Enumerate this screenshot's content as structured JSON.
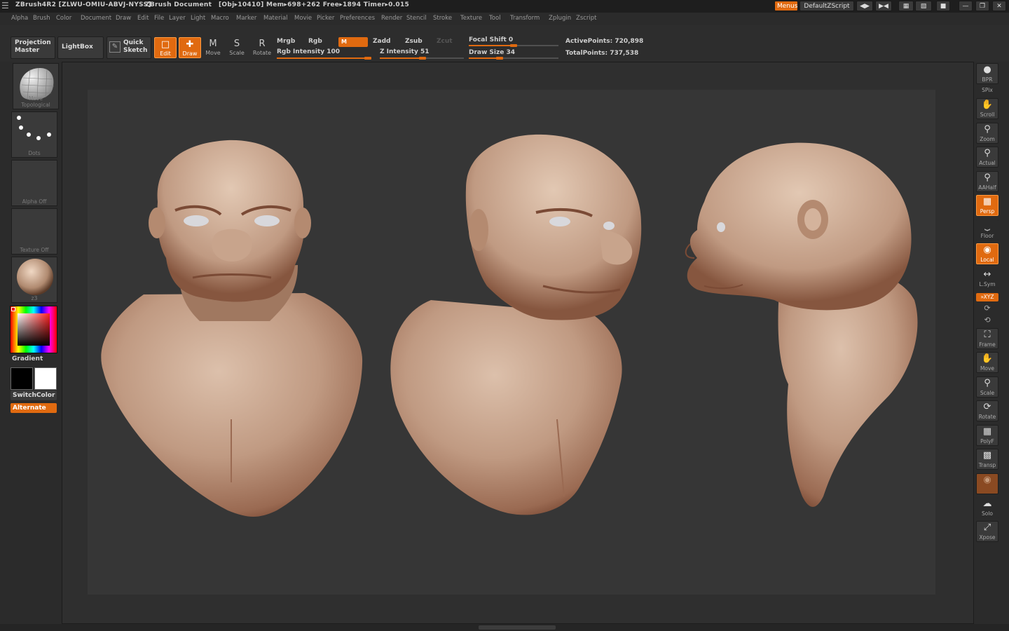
{
  "titlebar": {
    "app": "ZBrush4R2 [ZLWU-OMIU-ABVJ-NYSS]",
    "document": "ZBrush Document",
    "stats": "[Obj▸10410] Mem▸698+262  Free▸1894  Timer▸0.015",
    "menus_button": "Menus",
    "script_button": "DefaultZScript"
  },
  "menus": [
    "Alpha",
    "Brush",
    "Color",
    "Document",
    "Draw",
    "Edit",
    "File",
    "Layer",
    "Light",
    "Macro",
    "Marker",
    "Material",
    "Movie",
    "Picker",
    "Preferences",
    "Render",
    "Stencil",
    "Stroke",
    "Texture",
    "Tool",
    "Transform",
    "Zplugin",
    "Zscript"
  ],
  "toolbar": {
    "projection_master": "Projection Master",
    "lightbox": "LightBox",
    "quick_sketch": "Quick Sketch",
    "edit": "Edit",
    "draw": "Draw",
    "move": "Move",
    "scale": "Scale",
    "rotate": "Rotate",
    "mrgb": "Mrgb",
    "rgb": "Rgb",
    "m": "M",
    "zadd": "Zadd",
    "zsub": "Zsub",
    "zcut": "Zcut",
    "rgb_intensity": "Rgb Intensity 100",
    "rgb_intensity_value": 1.0,
    "z_intensity": "Z Intensity 51",
    "z_intensity_value": 0.51,
    "focal_shift": "Focal Shift 0",
    "focal_shift_value": 0.5,
    "draw_size": "Draw Size 34",
    "draw_size_value": 0.34,
    "active_points": "ActivePoints: 720,898",
    "total_points": "TotalPoints: 737,538"
  },
  "left": {
    "brush_caption": "Move Topological",
    "stroke_caption": "Dots",
    "alpha_caption": "Alpha Off",
    "texture_caption": "Texture Off",
    "material_caption": "z3",
    "gradient": "Gradient",
    "switch_color": "SwitchColor",
    "alternate": "Alternate"
  },
  "right": {
    "bpr": "BPR",
    "spix": "SPix",
    "scroll": "Scroll",
    "zoom": "Zoom",
    "actual": "Actual",
    "aahalf": "AAHalf",
    "persp": "Persp",
    "floor": "Floor",
    "local": "Local",
    "lsym": "L.Sym",
    "xyz": "»XYZ",
    "frame": "Frame",
    "move": "Move",
    "scale": "Scale",
    "rotate": "Rotate",
    "polyf": "PolyF",
    "transp": "Transp",
    "solo": "Solo",
    "xpose": "Xpose"
  },
  "colors": {
    "accent": "#e06a10",
    "skin_light": "#d9b9a3",
    "skin_mid": "#b98f77",
    "skin_dark": "#7a4a35"
  }
}
